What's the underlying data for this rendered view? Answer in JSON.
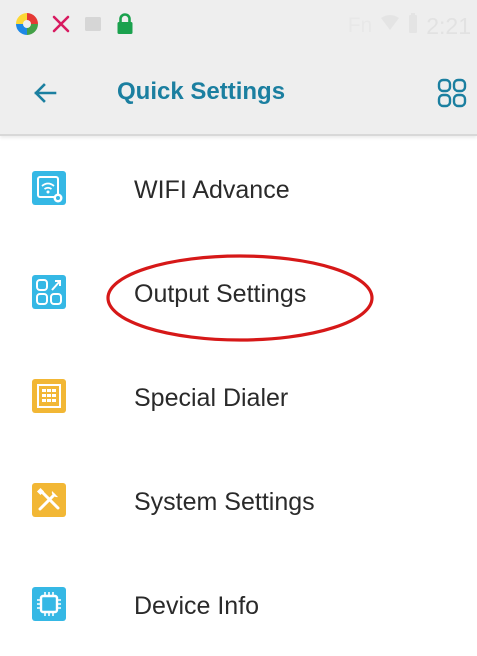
{
  "status_bar": {
    "right_text": "Fn",
    "time": "2:21"
  },
  "header": {
    "title": "Quick Settings"
  },
  "menu": {
    "items": [
      {
        "label": "WIFI Advance",
        "icon": "wifi-settings-icon",
        "color": "#35b8e5"
      },
      {
        "label": "Output Settings",
        "icon": "output-settings-icon",
        "color": "#35b8e5"
      },
      {
        "label": "Special Dialer",
        "icon": "dialer-keypad-icon",
        "color": "#f2b735"
      },
      {
        "label": "System Settings",
        "icon": "tools-icon",
        "color": "#f2b735"
      },
      {
        "label": "Device Info",
        "icon": "chip-icon",
        "color": "#35b8e5"
      }
    ]
  },
  "colors": {
    "accent": "#1b7fa0",
    "highlight": "#d61818"
  }
}
